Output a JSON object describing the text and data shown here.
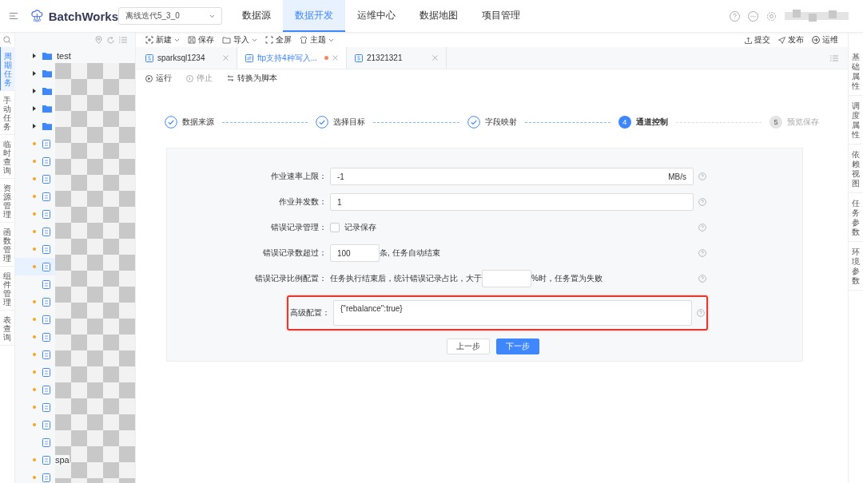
{
  "header": {
    "product": "BatchWorks",
    "project_select": "离线迭代5_3_0",
    "nav": [
      {
        "label": "数据源",
        "selected": false
      },
      {
        "label": "数据开发",
        "selected": true
      },
      {
        "label": "运维中心",
        "selected": false
      },
      {
        "label": "数据地图",
        "selected": false
      },
      {
        "label": "项目管理",
        "selected": false
      }
    ]
  },
  "left_rail": [
    {
      "label": "周期任务",
      "selected": true
    },
    {
      "label": "手动任务",
      "selected": false
    },
    {
      "label": "临时查询",
      "selected": false
    },
    {
      "label": "资源管理",
      "selected": false
    },
    {
      "label": "函数管理",
      "selected": false
    },
    {
      "label": "组件管理",
      "selected": false
    },
    {
      "label": "表查询",
      "selected": false
    }
  ],
  "tree": [
    {
      "kind": "folder",
      "label": "test",
      "modified": false,
      "selected": false
    },
    {
      "kind": "folder",
      "modified": false,
      "selected": false
    },
    {
      "kind": "folder",
      "modified": false,
      "selected": false
    },
    {
      "kind": "folder",
      "modified": false,
      "selected": false
    },
    {
      "kind": "folder",
      "modified": false,
      "selected": false
    },
    {
      "kind": "file",
      "modified": true,
      "selected": false
    },
    {
      "kind": "file",
      "modified": true,
      "selected": false
    },
    {
      "kind": "file",
      "modified": true,
      "selected": false
    },
    {
      "kind": "file",
      "modified": true,
      "selected": false
    },
    {
      "kind": "file",
      "modified": true,
      "selected": false
    },
    {
      "kind": "file",
      "modified": true,
      "selected": false
    },
    {
      "kind": "file",
      "modified": true,
      "selected": false
    },
    {
      "kind": "file",
      "modified": true,
      "selected": true
    },
    {
      "kind": "file",
      "modified": false,
      "selected": false
    },
    {
      "kind": "file",
      "modified": true,
      "selected": false
    },
    {
      "kind": "file",
      "modified": true,
      "selected": false
    },
    {
      "kind": "file",
      "modified": true,
      "selected": false
    },
    {
      "kind": "file",
      "modified": true,
      "selected": false
    },
    {
      "kind": "file",
      "modified": true,
      "selected": false
    },
    {
      "kind": "file",
      "modified": true,
      "selected": false
    },
    {
      "kind": "file",
      "modified": true,
      "selected": false
    },
    {
      "kind": "file",
      "modified": true,
      "selected": false
    },
    {
      "kind": "file",
      "modified": false,
      "selected": false
    },
    {
      "kind": "file",
      "label": "spa",
      "modified": true,
      "selected": false
    },
    {
      "kind": "file",
      "modified": true,
      "selected": false
    }
  ],
  "toolbar": {
    "left": [
      {
        "label": "新建",
        "dropdown": true
      },
      {
        "label": "保存",
        "dropdown": false
      },
      {
        "label": "导入",
        "dropdown": true
      },
      {
        "label": "全屏",
        "dropdown": false
      },
      {
        "label": "主题",
        "dropdown": true
      }
    ],
    "right": [
      "提交",
      "发布",
      "运维"
    ]
  },
  "tabs": [
    {
      "label": "sparksql1234",
      "selected": false,
      "modified": false
    },
    {
      "label": "ftp支持4种写入...",
      "selected": true,
      "modified": true
    },
    {
      "label": "21321321",
      "selected": false,
      "modified": false
    }
  ],
  "actions": [
    {
      "label": "运行",
      "disabled": false
    },
    {
      "label": "停止",
      "disabled": true
    },
    {
      "label": "转换为脚本",
      "disabled": false
    }
  ],
  "steps": [
    {
      "label": "数据来源",
      "done": true,
      "selected": false
    },
    {
      "label": "选择目标",
      "done": true,
      "selected": false
    },
    {
      "label": "字段映射",
      "done": true,
      "selected": false
    },
    {
      "number": "4",
      "label": "通道控制",
      "done": false,
      "selected": true
    },
    {
      "number": "5",
      "label": "预览保存",
      "done": false,
      "selected": false
    }
  ],
  "form": [
    {
      "kind": "input",
      "label": "作业速率上限：",
      "value": "-1",
      "suffix": "MB/s",
      "highlighted": false
    },
    {
      "kind": "input",
      "label": "作业并发数：",
      "value": "1",
      "highlighted": false
    },
    {
      "kind": "checkbox",
      "label": "错误记录管理：",
      "text": "记录保存",
      "checked": false,
      "highlighted": false
    },
    {
      "kind": "inline",
      "label": "错误记录数超过：",
      "value": "100",
      "after": "条, 任务自动结束",
      "highlighted": false
    },
    {
      "kind": "inline",
      "label": "错误记录比例配置：",
      "before": "任务执行结束后，统计错误记录占比，大于",
      "after": "%时，任务置为失败",
      "highlighted": false
    },
    {
      "kind": "textarea",
      "label": "高级配置：",
      "value": "{\"rebalance\":true}",
      "highlighted": true
    }
  ],
  "buttons": [
    {
      "label": "上一步",
      "primary": false
    },
    {
      "label": "下一步",
      "primary": true
    }
  ],
  "right_rail": [
    "基础属性",
    "调度属性",
    "依赖视图",
    "任务参数",
    "环境参数"
  ]
}
